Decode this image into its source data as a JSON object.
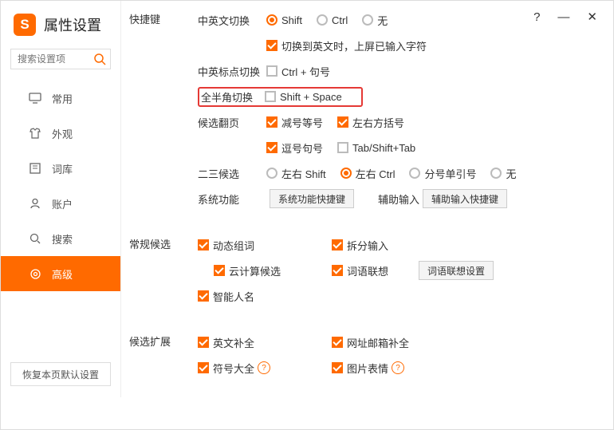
{
  "title": "属性设置",
  "search": {
    "placeholder": "搜索设置项"
  },
  "titlebar": {
    "help": "?",
    "min": "—",
    "close": "✕"
  },
  "sidebar": {
    "items": [
      {
        "label": "常用"
      },
      {
        "label": "外观"
      },
      {
        "label": "词库"
      },
      {
        "label": "账户"
      },
      {
        "label": "搜索"
      },
      {
        "label": "高级"
      }
    ],
    "restore": "恢复本页默认设置"
  },
  "sections": {
    "hotkey": {
      "title": "快捷键",
      "cnEnSwitch": {
        "label": "中英文切换",
        "options": [
          "Shift",
          "Ctrl",
          "无"
        ],
        "selected": 0
      },
      "switchNote": "切换到英文时，上屏已输入字符",
      "punctSwitch": {
        "label": "中英标点切换",
        "option": "Ctrl + 句号"
      },
      "fullHalf": {
        "label": "全半角切换",
        "option": "Shift + Space"
      },
      "pageTurn": {
        "label": "候选翻页",
        "options": [
          "减号等号",
          "左右方括号",
          "逗号句号",
          "Tab/Shift+Tab"
        ]
      },
      "cand23": {
        "label": "二三候选",
        "options": [
          "左右 Shift",
          "左右 Ctrl",
          "分号单引号",
          "无"
        ],
        "selected": 1
      },
      "sysFunc": {
        "label": "系统功能",
        "btn": "系统功能快捷键"
      },
      "auxInput": {
        "label": "辅助输入",
        "btn": "辅助输入快捷键"
      }
    },
    "candidate": {
      "title": "常规候选",
      "options": [
        "动态组词",
        "拆分输入",
        "云计算候选",
        "词语联想",
        "智能人名"
      ],
      "assocBtn": "词语联想设置"
    },
    "extend": {
      "title": "候选扩展",
      "options": [
        "英文补全",
        "网址邮箱补全",
        "符号大全",
        "图片表情"
      ]
    }
  }
}
